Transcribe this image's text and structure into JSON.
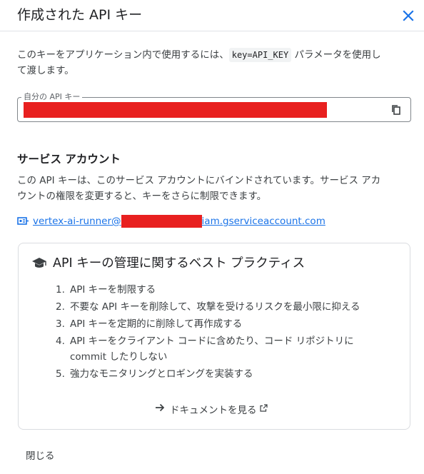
{
  "dialog": {
    "title": "作成された API キー",
    "close_icon": "close-icon"
  },
  "intro": {
    "text_before": "このキーをアプリケーション内で使用するには、",
    "code": "key=API_KEY",
    "text_after": " パラメータを使用して渡します。"
  },
  "api_key_field": {
    "label": "自分の API キー",
    "value_redacted": true,
    "copy_icon": "copy-icon"
  },
  "service_account": {
    "heading": "サービス アカウント",
    "description": "この API キーは、このサービス アカウントにバインドされています。サービス アカウントの権限を変更すると、キーをさらに制限できます。",
    "email_prefix": "vertex-ai-runner@",
    "email_suffix": "iam.gserviceaccount.com",
    "icon": "service-account-icon"
  },
  "best_practices": {
    "icon": "graduation-cap-icon",
    "title": "API キーの管理に関するベスト プラクティス",
    "items": [
      {
        "num": "1.",
        "text": "API キーを制限する"
      },
      {
        "num": "2.",
        "text": "不要な API キーを削除して、攻撃を受けるリスクを最小限に抑える"
      },
      {
        "num": "3.",
        "text": "API キーを定期的に削除して再作成する"
      },
      {
        "num": "4.",
        "text": "API キーをクライアント コードに含めたり、コード リポジトリに commit したりしない"
      },
      {
        "num": "5.",
        "text": "強力なモニタリングとロギングを実装する"
      }
    ],
    "doc_link_label": "ドキュメントを見る"
  },
  "footer": {
    "close_label": "閉じる"
  },
  "colors": {
    "link": "#1a73e8",
    "redaction": "#e8201f",
    "border": "#dadce0"
  }
}
